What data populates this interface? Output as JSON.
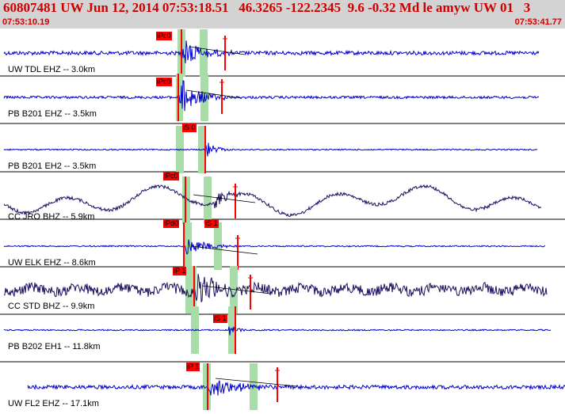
{
  "header": {
    "title": "60807481 UW Jun 12, 2014 07:53:18.51   46.3265 -122.2345  9.6 -0.32 Md le amyw UW 01   3",
    "time_start": "07:53:10.19",
    "time_end": "07:53:41.77"
  },
  "colors": {
    "header_bg": "#d3d3d3",
    "header_text": "#cc0000",
    "trace_blue": "#0000cc",
    "trace_navy": "#1a1060",
    "pick_red": "#ff0000",
    "window_green": "#a8dca8"
  },
  "traces": [
    {
      "label": "UW TDL EHZ -- 3.0km",
      "color": "navy_blue",
      "picks": [
        "iPc0"
      ]
    },
    {
      "label": "PB B201 EHZ -- 3.5km",
      "color": "navy_blue",
      "picks": [
        "iPc0"
      ]
    },
    {
      "label": "PB B201 EH2 -- 3.5km",
      "color": "navy_blue",
      "picks": [
        "iS 0"
      ]
    },
    {
      "label": "CC JRO BHZ -- 5.9km",
      "color": "navy",
      "picks": [
        "iPc0"
      ]
    },
    {
      "label": "UW ELK EHZ -- 8.6km",
      "color": "navy_blue",
      "picks": [
        "iPd0",
        "iS 1"
      ]
    },
    {
      "label": "CC STD BHZ -- 9.9km",
      "color": "navy",
      "picks": [
        "iP 1"
      ]
    },
    {
      "label": "PB B202 EH1 -- 11.8km",
      "color": "navy_blue",
      "picks": [
        "iS 1"
      ]
    },
    {
      "label": "UW FL2 EHZ -- 17.1km",
      "color": "navy_blue",
      "picks": [
        "iP 1"
      ]
    }
  ]
}
